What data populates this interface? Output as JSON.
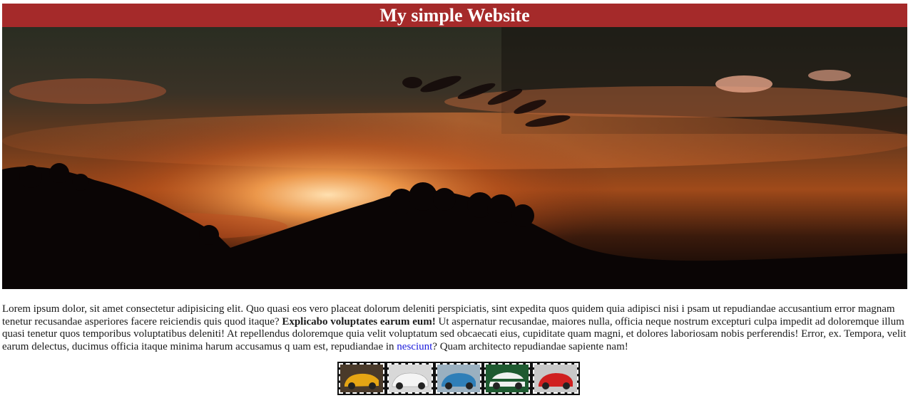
{
  "header": {
    "title": "My simple Website"
  },
  "hero": {
    "alt": "sunset"
  },
  "content": {
    "text_1": "Lorem ipsum dolor, sit amet consectetur adipisicing elit. Quo quasi eos vero placeat dolorum deleniti perspiciatis, sint expedita quos quidem quia adipisci nisi i psam ut repudiandae accusantium error magnam tenetur recusandae asperiores facere reiciendis quis quod itaque? ",
    "bold": "Explicabo voluptates earum eum!",
    "text_2": " Ut aspernatur recusandae, maiores nulla, officia neque nostrum excepturi culpa impedit ad doloremque illum quasi tenetur quos temporibus voluptatibus deleniti! At repellendus doloremque quia velit voluptatum sed obcaecati eius, cupiditate quam magni, et dolores laboriosam nobis perferendis! Error, ex. Tempora, velit earum delectus, ducimus officia itaque minima harum accusamus q uam est, repudiandae in ",
    "link": "nesciunt",
    "text_3": "? Quam architecto repudiandae sapiente nam!"
  },
  "gallery": {
    "thumbs": [
      {
        "icon": "yellow-car",
        "color": "#e5a514"
      },
      {
        "icon": "white-car",
        "color": "#e8e8e8"
      },
      {
        "icon": "blue-car",
        "color": "#2f7fb8"
      },
      {
        "icon": "green-white-car",
        "color": "#f0f0f0"
      },
      {
        "icon": "red-car",
        "color": "#d02020"
      }
    ]
  }
}
